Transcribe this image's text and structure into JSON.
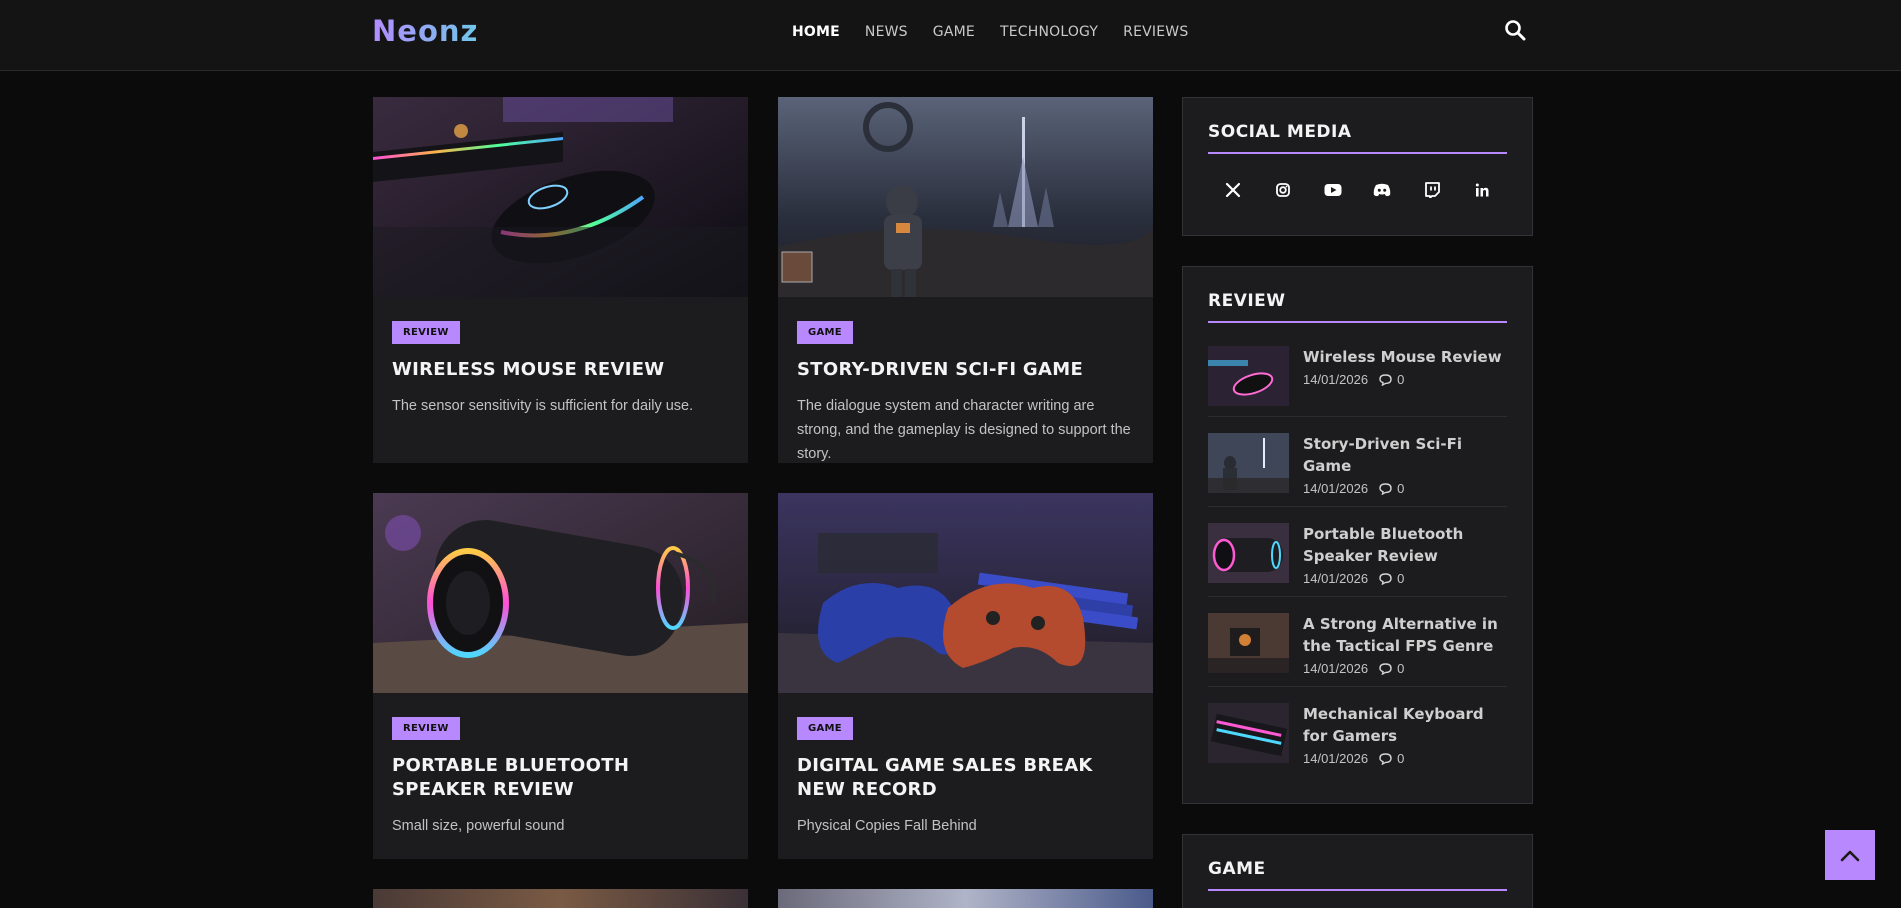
{
  "header": {
    "logo": "Neonz",
    "nav": [
      {
        "label": "HOME",
        "active": true
      },
      {
        "label": "NEWS",
        "active": false
      },
      {
        "label": "GAME",
        "active": false
      },
      {
        "label": "TECHNOLOGY",
        "active": false
      },
      {
        "label": "REVIEWS",
        "active": false
      }
    ],
    "search_icon": "search-icon"
  },
  "posts": [
    {
      "category": "REVIEW",
      "title": "WIRELESS MOUSE REVIEW",
      "excerpt": "The sensor sensitivity is sufficient for daily use.",
      "image": "gaming-mouse"
    },
    {
      "category": "GAME",
      "title": "STORY-DRIVEN SCI-FI GAME",
      "excerpt": "The dialogue system and character writing are strong, and the gameplay is designed to support the story.",
      "image": "sci-fi-astronaut"
    },
    {
      "category": "REVIEW",
      "title": "PORTABLE BLUETOOTH SPEAKER REVIEW",
      "excerpt": "Small size, powerful sound",
      "image": "bluetooth-speaker"
    },
    {
      "category": "GAME",
      "title": "DIGITAL GAME SALES BREAK NEW RECORD",
      "excerpt": "Physical Copies Fall Behind",
      "image": "game-controllers"
    }
  ],
  "sidebar": {
    "social": {
      "title": "SOCIAL MEDIA",
      "icons": [
        "x-icon",
        "instagram-icon",
        "youtube-icon",
        "discord-icon",
        "twitch-icon",
        "linkedin-icon"
      ]
    },
    "review": {
      "title": "REVIEW",
      "items": [
        {
          "title": "Wireless Mouse Review",
          "date": "14/01/2026",
          "comments": "0"
        },
        {
          "title": "Story-Driven Sci-Fi Game",
          "date": "14/01/2026",
          "comments": "0"
        },
        {
          "title": "Portable Bluetooth Speaker Review",
          "date": "14/01/2026",
          "comments": "0"
        },
        {
          "title": "A Strong Alternative in the Tactical FPS Genre",
          "date": "14/01/2026",
          "comments": "0"
        },
        {
          "title": "Mechanical Keyboard for Gamers",
          "date": "14/01/2026",
          "comments": "0"
        }
      ]
    },
    "game": {
      "title": "GAME"
    }
  },
  "colors": {
    "accent": "#b888ff",
    "background": "#0b0b0c",
    "card": "#1c1c1e"
  }
}
